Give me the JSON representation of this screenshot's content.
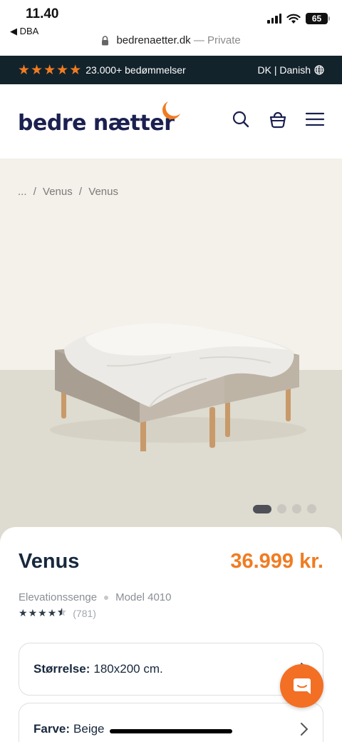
{
  "status_bar": {
    "time": "11.40",
    "back_app": "DBA",
    "battery": "65"
  },
  "url_bar": {
    "domain": "bedrenaetter.dk",
    "mode": "— Private"
  },
  "rating_banner": {
    "stars": 5,
    "text": "23.000+ bedømmelser",
    "language": "DK | Danish",
    "star_color": "#f07c22",
    "background": "#13232c"
  },
  "header": {
    "logo_text": "bedre nætter",
    "icons": [
      "search-icon",
      "basket-icon",
      "menu-icon"
    ]
  },
  "breadcrumb": [
    "...",
    "/",
    "Venus",
    "/",
    "Venus"
  ],
  "carousel": {
    "total": 4,
    "active": 1
  },
  "product": {
    "name": "Venus",
    "price": "36.999 kr.",
    "category": "Elevationssenge",
    "model": "Model 4010",
    "rating": 4.5,
    "review_count": "(781)",
    "price_color": "#f07c22"
  },
  "options": {
    "size_label": "Størrelse:",
    "size_value": "180x200 cm.",
    "color_label": "Farve:",
    "color_value": "Beige"
  },
  "chat": {
    "icon": "chat-icon",
    "color": "#f36f24"
  }
}
